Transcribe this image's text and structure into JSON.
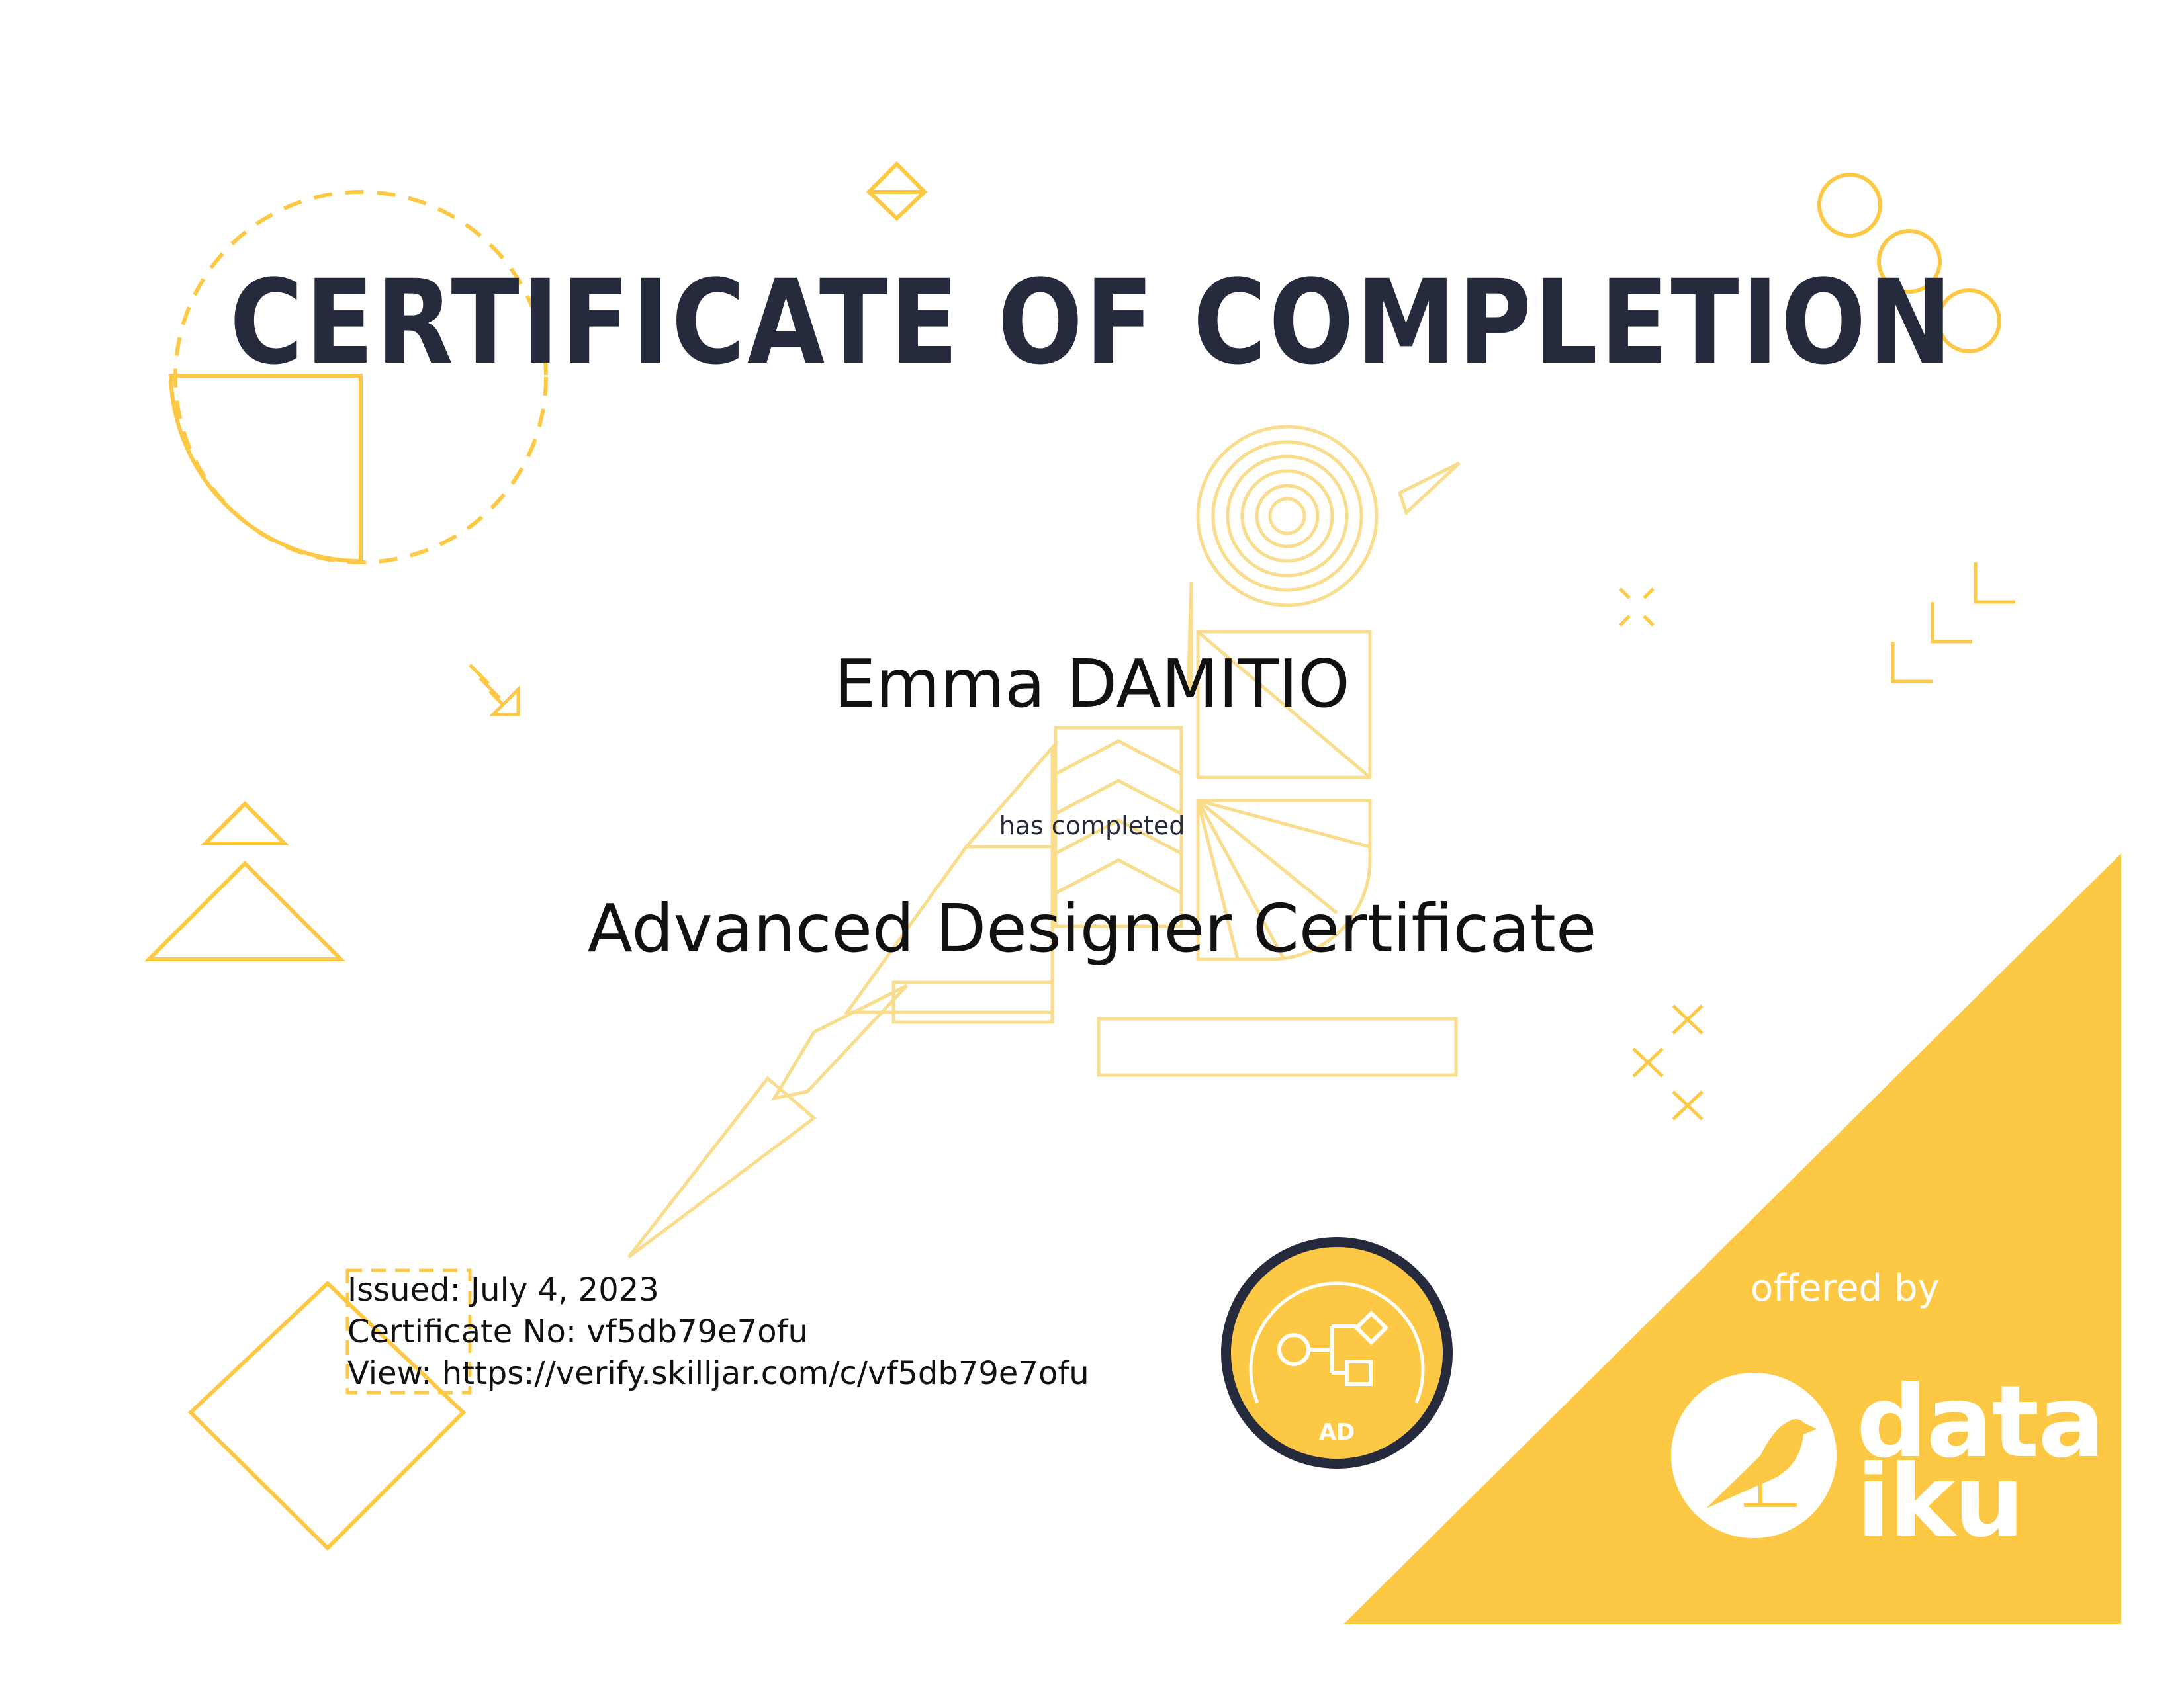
{
  "certificate": {
    "title": "CERTIFICATE OF COMPLETION",
    "recipient_name": "Emma DAMITIO",
    "has_completed": "has completed",
    "course_name": "Advanced Designer Certificate",
    "issued": "Issued: July 4, 2023",
    "certificate_no": "Certificate No: vf5db79e7ofu",
    "view_url": "View: https://verify.skilljar.com/c/vf5db79e7ofu"
  },
  "badge": {
    "label": "AD",
    "icon": "flow-diagram-icon"
  },
  "branding": {
    "offered_by": "offered by",
    "logo_line1": "data",
    "logo_line2": "iku",
    "logo_icon": "bird-icon"
  },
  "colors": {
    "accent_yellow": "#fdc945",
    "line_yellow": "#f9d77a",
    "title_navy": "#262a3d",
    "text_black": "#111111"
  }
}
